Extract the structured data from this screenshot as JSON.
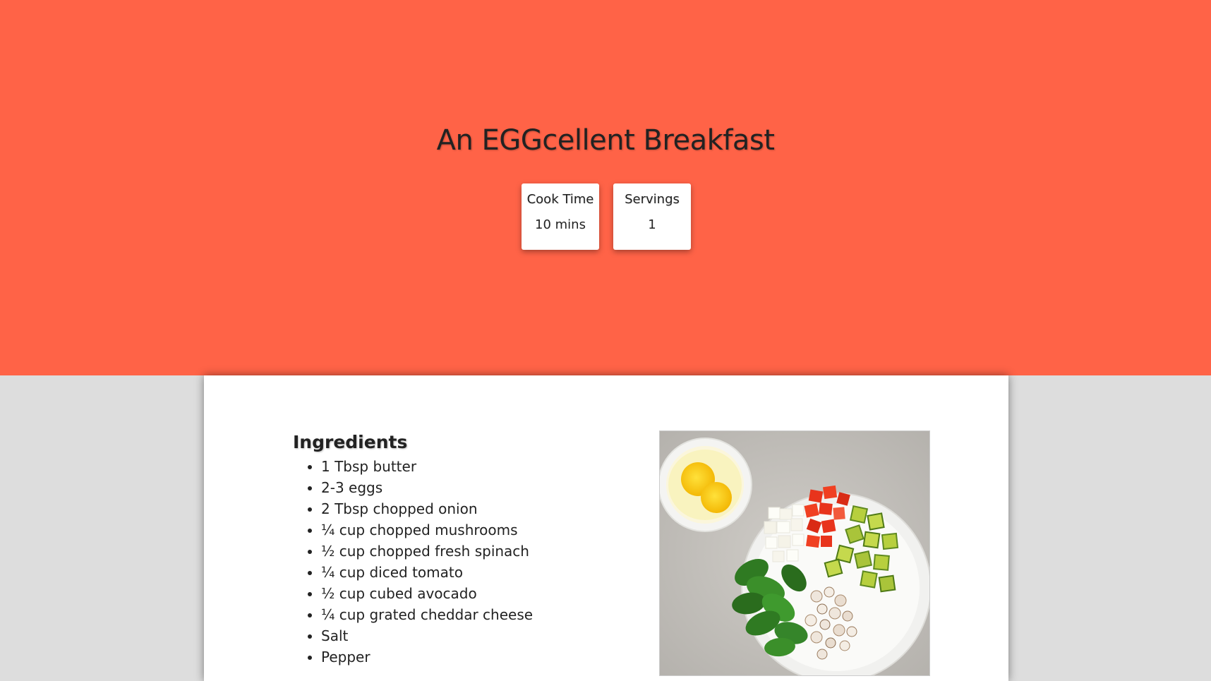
{
  "recipe": {
    "title": "An EGGcellent Breakfast",
    "stats": {
      "cook_time_label": "Cook Time",
      "cook_time_value": "10 mins",
      "servings_label": "Servings",
      "servings_value": "1"
    },
    "ingredients": {
      "title": "Ingredients",
      "items": [
        "1 Tbsp butter",
        "2-3 eggs",
        "2 Tbsp chopped onion",
        "¼ cup chopped mushrooms",
        "½ cup chopped fresh spinach",
        "¼ cup diced tomato",
        "½ cup cubed avocado",
        "¼ cup grated cheddar cheese",
        "Salt",
        "Pepper"
      ]
    },
    "photo": {
      "subject": "bowl of cracked eggs beside a plate of chopped onion, tomato, avocado, spinach and mushrooms"
    }
  },
  "colors": {
    "hero_background": "#ff6347",
    "page_background": "#dddddd",
    "card_background": "#ffffff",
    "text": "#222222"
  }
}
